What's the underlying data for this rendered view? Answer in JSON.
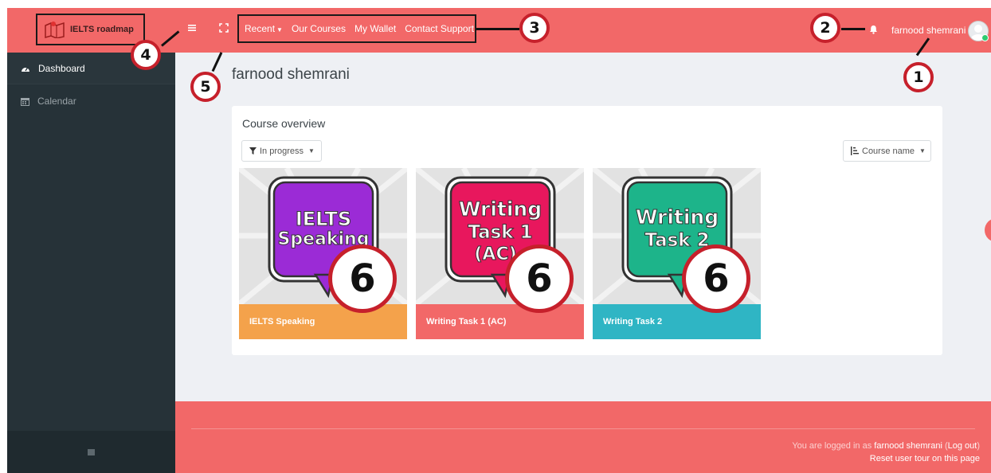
{
  "brand": {
    "name": "IELTS roadmap"
  },
  "navbar": {
    "menu_icon": "hamburger-icon",
    "fullscreen_icon": "fullscreen-icon",
    "links": [
      {
        "label": "Recent",
        "has_caret": true
      },
      {
        "label": "Our Courses"
      },
      {
        "label": "My Wallet"
      },
      {
        "label": "Contact Support"
      }
    ],
    "notification_icon": "bell-icon",
    "user_name": "farnood shemrani",
    "online_status": "online"
  },
  "sidebar": {
    "items": [
      {
        "label": "Dashboard",
        "icon": "dashboard-icon",
        "active": true
      },
      {
        "label": "Calendar",
        "icon": "calendar-icon",
        "active": false
      }
    ]
  },
  "page": {
    "title": "farnood shemrani"
  },
  "course_overview": {
    "title": "Course overview",
    "filter_label": "In progress",
    "sort_label": "Course name",
    "courses": [
      {
        "name": "IELTS Speaking",
        "image_line1": "IELTS",
        "image_line2": "Speaking",
        "image_line3": "",
        "footer_color": "#f4a24b",
        "bubble_color": "#9b2bd6"
      },
      {
        "name": "Writing Task 1 (AC)",
        "image_line1": "Writing",
        "image_line2": "Task 1",
        "image_line3": "(AC)",
        "footer_color": "#f26868",
        "bubble_color": "#e8175d"
      },
      {
        "name": "Writing Task 2",
        "image_line1": "Writing",
        "image_line2": "Task 2",
        "image_line3": "",
        "footer_color": "#2fb5c4",
        "bubble_color": "#1db48a"
      }
    ]
  },
  "footer": {
    "logged_in_prefix": "You are logged in as",
    "user_link": "farnood shemrani",
    "logout_label": "Log out",
    "reset_tour_label": "Reset user tour on this page"
  },
  "annotations": [
    "1",
    "2",
    "3",
    "4",
    "5",
    "6",
    "6",
    "6"
  ],
  "colors": {
    "navbar": "#f26868",
    "sidebar": "#263238",
    "content_bg": "#eef0f4",
    "annotation_ring": "#c6202b"
  }
}
